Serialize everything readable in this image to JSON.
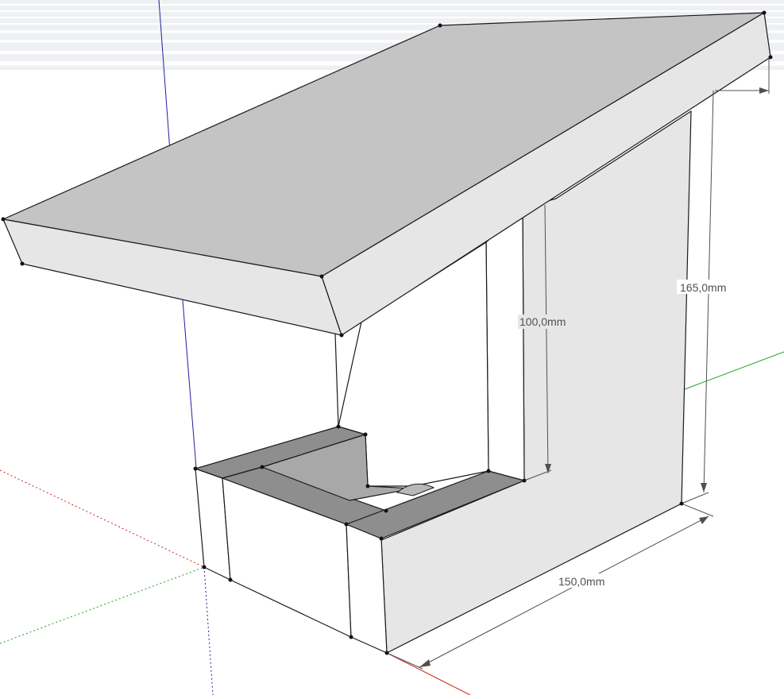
{
  "viewport": {
    "dimensions": {
      "height_short": "100,0mm",
      "height_tall": "165,0mm",
      "width": "150,0mm"
    },
    "axes": {
      "blue": "#1f1fa0",
      "red": "#d02020",
      "green": "#20a020"
    },
    "colors": {
      "sky_band": "#eef0f3",
      "top_face": "#c4c4c4",
      "side_face": "#e6e6e6",
      "shadow_face": "#8e8e8e"
    }
  }
}
